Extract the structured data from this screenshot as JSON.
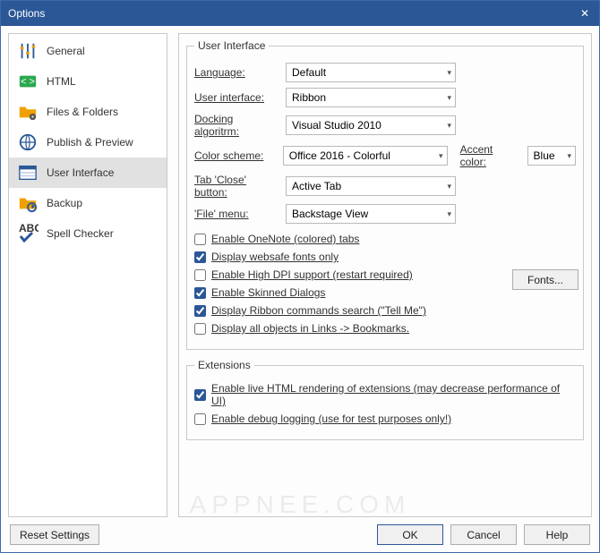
{
  "window": {
    "title": "Options"
  },
  "sidebar": {
    "items": [
      {
        "label": "General"
      },
      {
        "label": "HTML"
      },
      {
        "label": "Files & Folders"
      },
      {
        "label": "Publish & Preview"
      },
      {
        "label": "User Interface"
      },
      {
        "label": "Backup"
      },
      {
        "label": "Spell Checker"
      }
    ]
  },
  "groups": {
    "ui": {
      "legend": "User Interface",
      "language": {
        "label": "Language:",
        "value": "Default"
      },
      "uiStyle": {
        "label": "User interface:",
        "value": "Ribbon"
      },
      "docking": {
        "label": "Docking algoritrm:",
        "value": "Visual Studio 2010"
      },
      "scheme": {
        "label": "Color scheme:",
        "value": "Office 2016 - Colorful"
      },
      "accent": {
        "label": "Accent color:",
        "value": "Blue"
      },
      "tabClose": {
        "label": "Tab 'Close' button:",
        "value": "Active Tab"
      },
      "fileMenu": {
        "label": "'File' menu:",
        "value": "Backstage View"
      },
      "checks": {
        "onenote": {
          "label": "Enable OneNote (colored) tabs",
          "checked": false
        },
        "websafe": {
          "label": "Display websafe fonts only",
          "checked": true
        },
        "highdpi": {
          "label": "Enable High DPI support (restart required)",
          "checked": false
        },
        "skinned": {
          "label": "Enable Skinned Dialogs",
          "checked": true
        },
        "tellme": {
          "label": "Display Ribbon commands search (\"Tell Me\")",
          "checked": true
        },
        "linksbm": {
          "label": "Display all objects in Links -> Bookmarks.",
          "checked": false
        }
      },
      "fontsBtn": "Fonts..."
    },
    "ext": {
      "legend": "Extensions",
      "live": {
        "label": "Enable live HTML rendering of extensions (may decrease performance of UI)",
        "checked": true
      },
      "debug": {
        "label": "Enable debug logging (use for test purposes only!)",
        "checked": false
      }
    }
  },
  "footer": {
    "reset": "Reset Settings",
    "ok": "OK",
    "cancel": "Cancel",
    "help": "Help"
  },
  "watermark": "APPNEE.COM"
}
